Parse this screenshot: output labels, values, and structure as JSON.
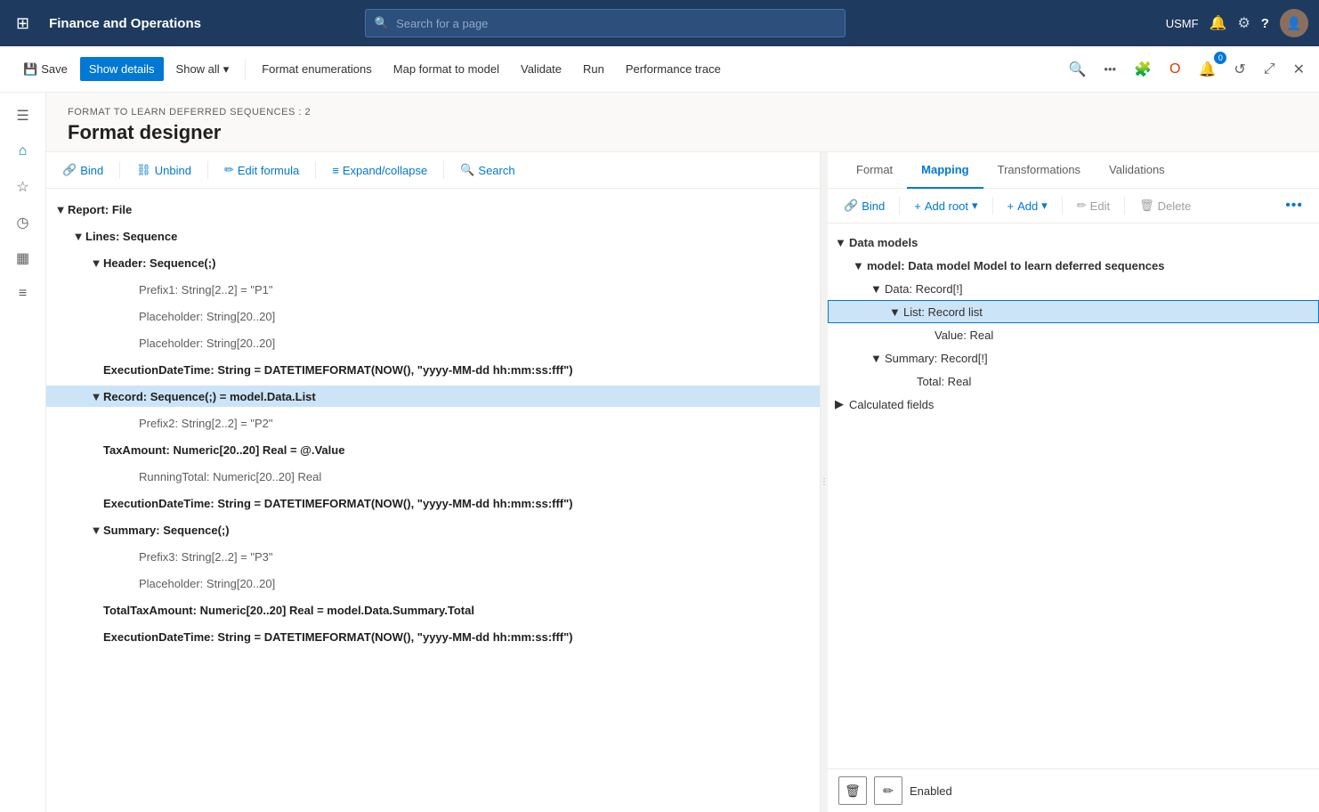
{
  "app": {
    "title": "Finance and Operations",
    "search_placeholder": "Search for a page",
    "user": "USMF"
  },
  "toolbar": {
    "save": "Save",
    "show_details": "Show details",
    "show_all": "Show all",
    "format_enumerations": "Format enumerations",
    "map_format_to_model": "Map format to model",
    "validate": "Validate",
    "run": "Run",
    "performance_trace": "Performance trace"
  },
  "page": {
    "breadcrumb": "FORMAT TO LEARN DEFERRED SEQUENCES : 2",
    "title": "Format designer"
  },
  "designer_toolbar": {
    "bind": "Bind",
    "unbind": "Unbind",
    "edit_formula": "Edit formula",
    "expand_collapse": "Expand/collapse",
    "search": "Search"
  },
  "tree": {
    "nodes": [
      {
        "id": 1,
        "level": 0,
        "indent": 0,
        "expanded": true,
        "label": "Report: File",
        "bold": true,
        "selected": false
      },
      {
        "id": 2,
        "level": 1,
        "indent": 1,
        "expanded": true,
        "label": "Lines: Sequence",
        "bold": true,
        "selected": false
      },
      {
        "id": 3,
        "level": 2,
        "indent": 2,
        "expanded": true,
        "label": "Header: Sequence(;)",
        "bold": true,
        "selected": false
      },
      {
        "id": 4,
        "level": 3,
        "indent": 3,
        "expanded": false,
        "label": "Prefix1: String[2..2] = \"P1\"",
        "bold": false,
        "selected": false
      },
      {
        "id": 5,
        "level": 3,
        "indent": 3,
        "expanded": false,
        "label": "Placeholder: String[20..20]",
        "bold": false,
        "selected": false
      },
      {
        "id": 6,
        "level": 3,
        "indent": 3,
        "expanded": false,
        "label": "Placeholder: String[20..20]",
        "bold": false,
        "selected": false
      },
      {
        "id": 7,
        "level": 3,
        "indent": 2,
        "expanded": false,
        "label": "ExecutionDateTime: String = DATETIMEFORMAT(NOW(), \"yyyy-MM-dd hh:mm:ss:fff\")",
        "bold": true,
        "selected": false
      },
      {
        "id": 8,
        "level": 2,
        "indent": 2,
        "expanded": true,
        "label": "Record: Sequence(;) = model.Data.List",
        "bold": true,
        "selected": true
      },
      {
        "id": 9,
        "level": 3,
        "indent": 3,
        "expanded": false,
        "label": "Prefix2: String[2..2] = \"P2\"",
        "bold": false,
        "selected": false
      },
      {
        "id": 10,
        "level": 3,
        "indent": 2,
        "expanded": false,
        "label": "TaxAmount: Numeric[20..20] Real = @.Value",
        "bold": true,
        "selected": false
      },
      {
        "id": 11,
        "level": 3,
        "indent": 3,
        "expanded": false,
        "label": "RunningTotal: Numeric[20..20] Real",
        "bold": false,
        "selected": false
      },
      {
        "id": 12,
        "level": 3,
        "indent": 2,
        "expanded": false,
        "label": "ExecutionDateTime: String = DATETIMEFORMAT(NOW(), \"yyyy-MM-dd hh:mm:ss:fff\")",
        "bold": true,
        "selected": false
      },
      {
        "id": 13,
        "level": 2,
        "indent": 2,
        "expanded": true,
        "label": "Summary: Sequence(;)",
        "bold": true,
        "selected": false
      },
      {
        "id": 14,
        "level": 3,
        "indent": 3,
        "expanded": false,
        "label": "Prefix3: String[2..2] = \"P3\"",
        "bold": false,
        "selected": false
      },
      {
        "id": 15,
        "level": 3,
        "indent": 3,
        "expanded": false,
        "label": "Placeholder: String[20..20]",
        "bold": false,
        "selected": false
      },
      {
        "id": 16,
        "level": 3,
        "indent": 2,
        "expanded": false,
        "label": "TotalTaxAmount: Numeric[20..20] Real = model.Data.Summary.Total",
        "bold": true,
        "selected": false
      },
      {
        "id": 17,
        "level": 3,
        "indent": 2,
        "expanded": false,
        "label": "ExecutionDateTime: String = DATETIMEFORMAT(NOW(), \"yyyy-MM-dd hh:mm:ss:fff\")",
        "bold": true,
        "selected": false
      }
    ]
  },
  "right_panel": {
    "tabs": [
      {
        "id": "format",
        "label": "Format"
      },
      {
        "id": "mapping",
        "label": "Mapping"
      },
      {
        "id": "transformations",
        "label": "Transformations"
      },
      {
        "id": "validations",
        "label": "Validations"
      }
    ],
    "active_tab": "mapping",
    "toolbar": {
      "bind": "Bind",
      "add_root": "Add root",
      "add": "Add",
      "edit": "Edit",
      "delete": "Delete"
    },
    "tree": {
      "nodes": [
        {
          "id": 1,
          "level": 0,
          "indent": 0,
          "expanded": true,
          "label": "Data models",
          "bold": true,
          "selected": false
        },
        {
          "id": 2,
          "level": 1,
          "indent": 1,
          "expanded": true,
          "label": "model: Data model Model to learn deferred sequences",
          "bold": true,
          "selected": false
        },
        {
          "id": 3,
          "level": 2,
          "indent": 2,
          "expanded": true,
          "label": "Data: Record[!]",
          "bold": false,
          "selected": false
        },
        {
          "id": 4,
          "level": 3,
          "indent": 3,
          "expanded": true,
          "label": "List: Record list",
          "bold": false,
          "selected": true
        },
        {
          "id": 5,
          "level": 4,
          "indent": 4,
          "expanded": false,
          "label": "Value: Real",
          "bold": false,
          "selected": false
        },
        {
          "id": 6,
          "level": 2,
          "indent": 2,
          "expanded": true,
          "label": "Summary: Record[!]",
          "bold": false,
          "selected": false
        },
        {
          "id": 7,
          "level": 3,
          "indent": 3,
          "expanded": false,
          "label": "Total: Real",
          "bold": false,
          "selected": false
        },
        {
          "id": 8,
          "level": 0,
          "indent": 0,
          "expanded": false,
          "label": "Calculated fields",
          "bold": false,
          "selected": false
        }
      ]
    },
    "bottom": {
      "enabled_text": "Enabled"
    }
  },
  "icons": {
    "grid": "⊞",
    "home": "⌂",
    "star": "☆",
    "history": "◷",
    "calendar": "▦",
    "list": "≡",
    "filter": "⊿",
    "save": "💾",
    "search": "🔍",
    "bell": "🔔",
    "gear": "⚙",
    "help": "?",
    "chevron_down": "▾",
    "chevron_right": "▶",
    "chevron_down_small": "▼",
    "expand": "▲",
    "link": "🔗",
    "unlink": "⛓",
    "formula": "✏",
    "expand_collapse": "⇅",
    "trash": "🗑",
    "edit": "✏",
    "more": "•••",
    "refresh": "↺",
    "maximize": "⤢",
    "close": "✕",
    "puzzle": "🧩"
  }
}
